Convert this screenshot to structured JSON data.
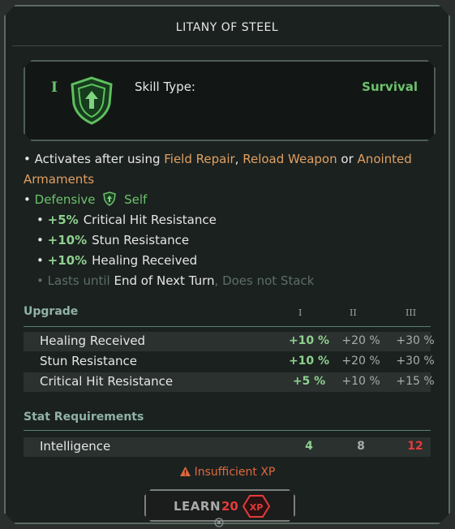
{
  "title": "LITANY OF STEEL",
  "skill": {
    "tier": "I",
    "type_label": "Skill Type:",
    "type_value": "Survival"
  },
  "description": {
    "bullet": "•",
    "activates_prefix": "Activates after using",
    "field_repair": "Field Repair",
    "comma": ",",
    "reload_weapon": "Reload Weapon",
    "or": "or",
    "anointed": "Anointed",
    "armaments": "Armaments",
    "defensive": "Defensive",
    "self": "Self",
    "effects": [
      {
        "value": "+5%",
        "label": "Critical Hit Resistance"
      },
      {
        "value": "+10%",
        "label": "Stun Resistance"
      },
      {
        "value": "+10%",
        "label": "Healing Received"
      }
    ],
    "lasts_until": "Lasts until",
    "end_of_turn": "End of Next Turn",
    "stack_prefix": ",",
    "does_not_stack": "Does not Stack"
  },
  "upgrade": {
    "header": "Upgrade",
    "levels": [
      "I",
      "II",
      "III"
    ],
    "rows": [
      {
        "label": "Healing Received",
        "v1": "+10 %",
        "v2": "+20 %",
        "v3": "+30 %"
      },
      {
        "label": "Stun Resistance",
        "v1": "+10 %",
        "v2": "+20 %",
        "v3": "+30 %"
      },
      {
        "label": "Critical Hit Resistance",
        "v1": "+5 %",
        "v2": "+10 %",
        "v3": "+15 %"
      }
    ]
  },
  "requirements": {
    "header": "Stat Requirements",
    "rows": [
      {
        "label": "Intelligence",
        "v1": "4",
        "v2": "8",
        "v3": "12"
      }
    ]
  },
  "warning": "Insufficient XP",
  "learn": {
    "label": "LEARN",
    "cost": "20",
    "currency": "XP"
  },
  "colors": {
    "accent_green": "#6cc36c",
    "highlight_orange": "#e0a062",
    "warning_red": "#e53b3b"
  }
}
